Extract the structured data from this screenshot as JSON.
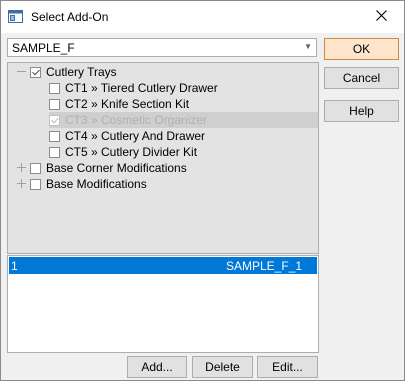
{
  "window": {
    "title": "Select Add-On"
  },
  "combo": {
    "value": "SAMPLE_F"
  },
  "buttons": {
    "ok": "OK",
    "cancel": "Cancel",
    "help": "Help",
    "add": "Add...",
    "delete": "Delete",
    "edit": "Edit..."
  },
  "tree": {
    "root": {
      "label": "Cutlery Trays",
      "checked": true
    },
    "children": [
      {
        "label": "CT1 » Tiered Cutlery Drawer",
        "checked": false
      },
      {
        "label": "CT2 » Knife Section Kit",
        "checked": false
      },
      {
        "label": "CT3 » Cosmetic Organizer",
        "checked": true,
        "disabled": true
      },
      {
        "label": "CT4 » Cutlery And Drawer",
        "checked": false
      },
      {
        "label": "CT5 » Cutlery Divider Kit",
        "checked": false
      }
    ],
    "others": [
      {
        "label": "Base Corner Modifications",
        "checked": false
      },
      {
        "label": "Base Modifications",
        "checked": false
      }
    ]
  },
  "list": {
    "rows": [
      {
        "index": "1",
        "name": "SAMPLE_F_1"
      }
    ]
  },
  "colors": {
    "selection": "#0078d7",
    "default_button_border": "#d08a3a"
  }
}
